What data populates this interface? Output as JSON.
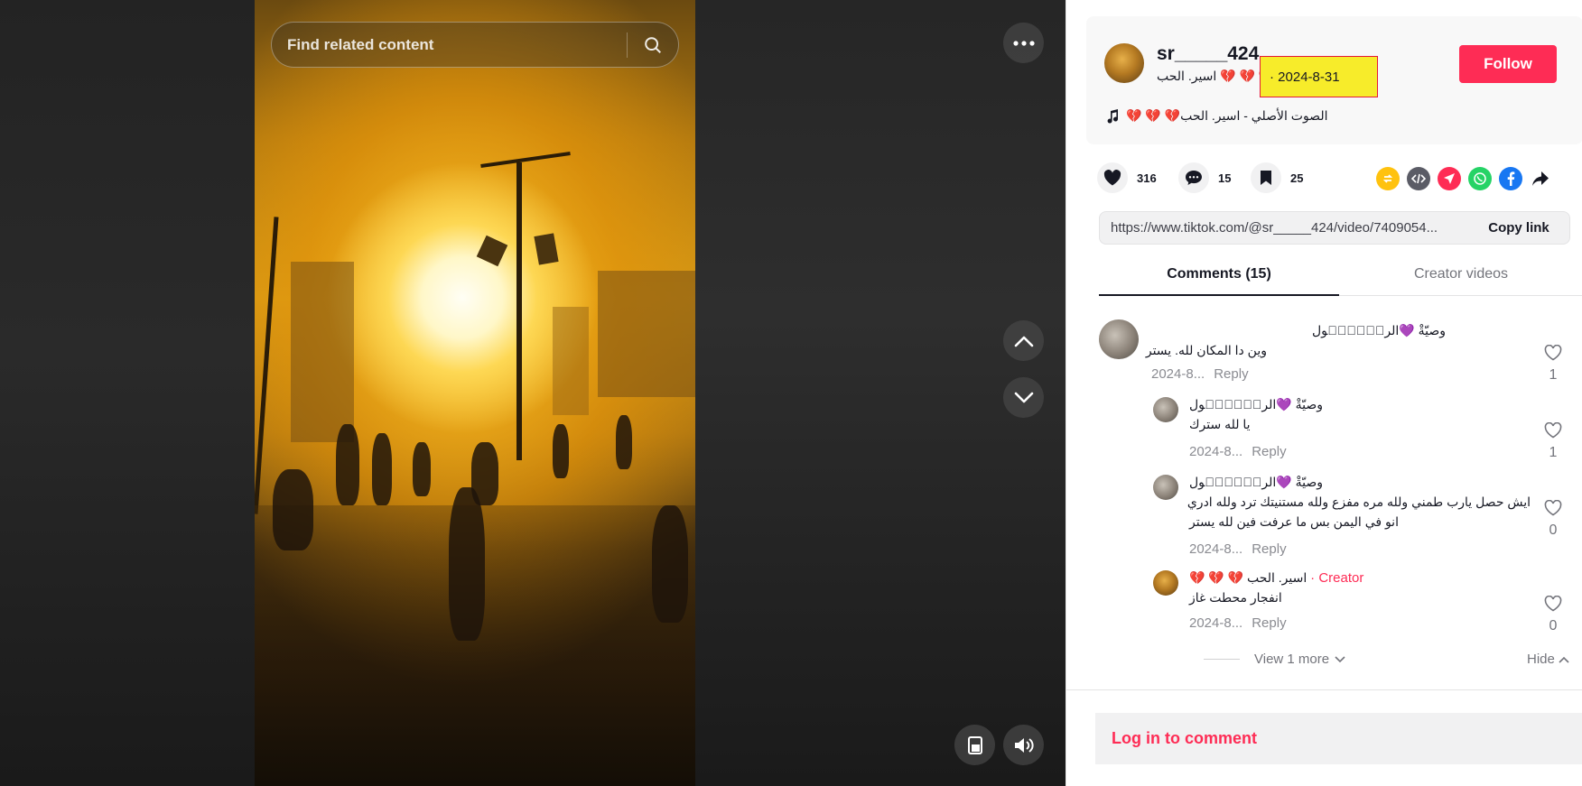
{
  "search": {
    "placeholder": "Find related content"
  },
  "video_controls": {
    "more_icon": "ellipsis-icon",
    "up_icon": "chevron-up-icon",
    "down_icon": "chevron-down-icon",
    "pip_icon": "floating-player-icon",
    "volume_icon": "speaker-icon"
  },
  "author": {
    "username": "sr_____424",
    "nickname": "اسير. الحب 💔 💔 💔",
    "date": "· 2024-8-31",
    "follow_label": "Follow",
    "music": "💔 💔 💔الصوت الأصلي - اسير. الحب"
  },
  "actions": {
    "likes": "316",
    "comments": "15",
    "saves": "25"
  },
  "share": {
    "link": "https://www.tiktok.com/@sr_____424/video/7409054...",
    "copy_label": "Copy link"
  },
  "tabs": {
    "comments": "Comments (15)",
    "creator": "Creator videos"
  },
  "comments": [
    {
      "name": "وصيّةْ 💜الرسّۣۗـۙول",
      "text": "وين دا المكان لله. يستر",
      "date": "2024-8...",
      "reply": "Reply",
      "likes": "1"
    },
    {
      "name": "وصيّةْ 💜الرسّۣۗـۙول",
      "text": "يا لله سترك",
      "date": "2024-8...",
      "reply": "Reply",
      "likes": "1"
    },
    {
      "name": "وصيّةْ 💜الرسّۣۗـۙول",
      "text": "ايش حصل يارب طمني ولله مره مفزع ولله مستنيتك ترد ولله ادري",
      "text2": "انو في اليمن بس ما عرفت فين لله يستر",
      "date": "2024-8...",
      "reply": "Reply",
      "likes": "0"
    },
    {
      "name": "اسير. الحب 💔 💔 💔",
      "creator_tag": "· Creator",
      "text": "انفجار محطت غاز",
      "date": "2024-8...",
      "reply": "Reply",
      "likes": "0"
    }
  ],
  "replies_footer": {
    "view_more": "View 1 more",
    "hide": "Hide"
  },
  "login": {
    "label": "Log in to comment"
  },
  "colors": {
    "accent": "#fe2c55",
    "highlight": "#f7ec2a"
  }
}
